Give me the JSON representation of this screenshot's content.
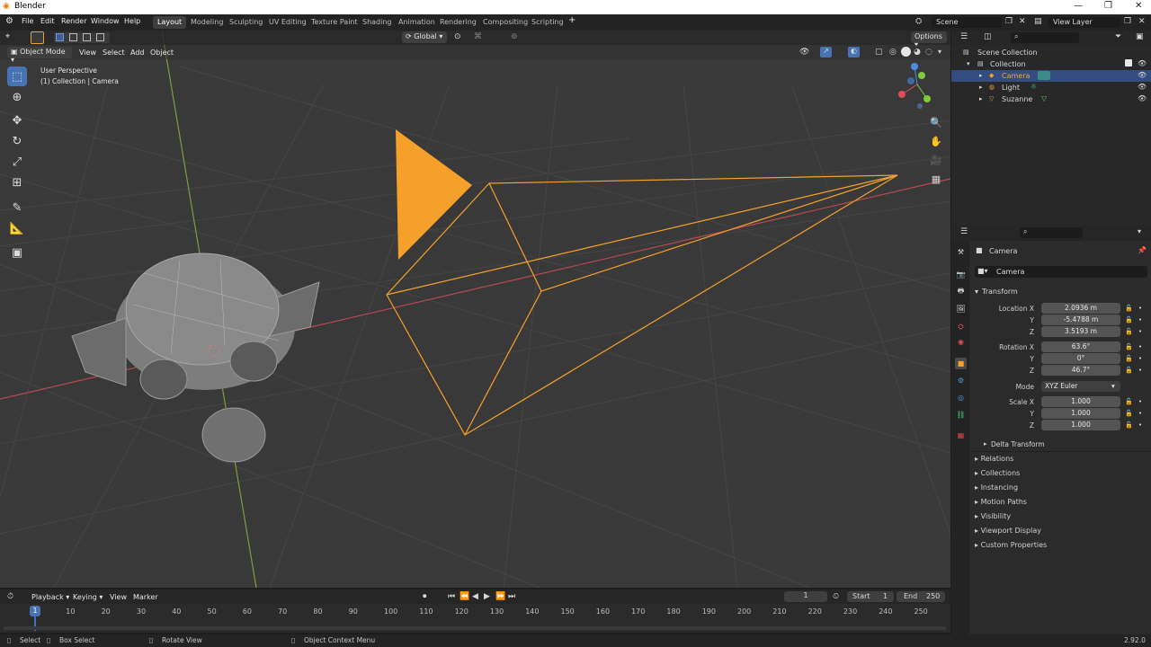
{
  "window": {
    "title": "Blender",
    "minimize": "—",
    "restore": "❐",
    "close": "✕"
  },
  "menu": [
    "File",
    "Edit",
    "Render",
    "Window",
    "Help"
  ],
  "workspaces": [
    {
      "label": "Layout",
      "active": true
    },
    {
      "label": "Modeling"
    },
    {
      "label": "Sculpting"
    },
    {
      "label": "UV Editing"
    },
    {
      "label": "Texture Paint"
    },
    {
      "label": "Shading"
    },
    {
      "label": "Animation"
    },
    {
      "label": "Rendering"
    },
    {
      "label": "Compositing"
    },
    {
      "label": "Scripting"
    }
  ],
  "add_workspace": "+",
  "scene": "Scene",
  "view_layer": "View Layer",
  "viewport": {
    "transform_orientation": "Global",
    "options": "Options",
    "mode": "Object Mode",
    "menus": [
      "View",
      "Select",
      "Add",
      "Object"
    ],
    "overlay_line1": "User Perspective",
    "overlay_line2": "(1) Collection | Camera"
  },
  "outliner": {
    "root": "Scene Collection",
    "collection": "Collection",
    "items": [
      "Camera",
      "Light",
      "Suzanne"
    ],
    "selected": "Camera"
  },
  "properties": {
    "context": "Camera",
    "object_name": "Camera",
    "transform_header": "Transform",
    "location": {
      "label": "Location X",
      "x": "2.0936 m",
      "y": "-5.4788 m",
      "z": "3.5193 m"
    },
    "rotation": {
      "label": "Rotation X",
      "x": "63.6°",
      "y": "0°",
      "z": "46.7°"
    },
    "mode_label": "Mode",
    "mode_value": "XYZ Euler",
    "scale": {
      "label": "Scale X",
      "x": "1.000",
      "y": "1.000",
      "z": "1.000"
    },
    "axis_y": "Y",
    "axis_z": "Z",
    "delta": "Delta Transform",
    "panels": [
      "Relations",
      "Collections",
      "Instancing",
      "Motion Paths",
      "Visibility",
      "Viewport Display",
      "Custom Properties"
    ]
  },
  "timeline": {
    "menus": [
      "Playback",
      "Keying",
      "View",
      "Marker"
    ],
    "current_frame": "1",
    "start_label": "Start",
    "start": "1",
    "end_label": "End",
    "end": "250",
    "ticks": [
      "1",
      "10",
      "20",
      "30",
      "40",
      "50",
      "60",
      "70",
      "80",
      "90",
      "100",
      "110",
      "120",
      "130",
      "140",
      "150",
      "160",
      "170",
      "180",
      "190",
      "200",
      "210",
      "220",
      "230",
      "240",
      "250"
    ]
  },
  "status": {
    "select": "Select",
    "box_select": "Box Select",
    "rotate_view": "Rotate View",
    "context_menu": "Object Context Menu",
    "version": "2.92.0"
  },
  "colors": {
    "accent": "#4772b3",
    "selected_orange": "#f5a02a",
    "x_axis": "#b84a52",
    "y_axis": "#7aa03c"
  }
}
